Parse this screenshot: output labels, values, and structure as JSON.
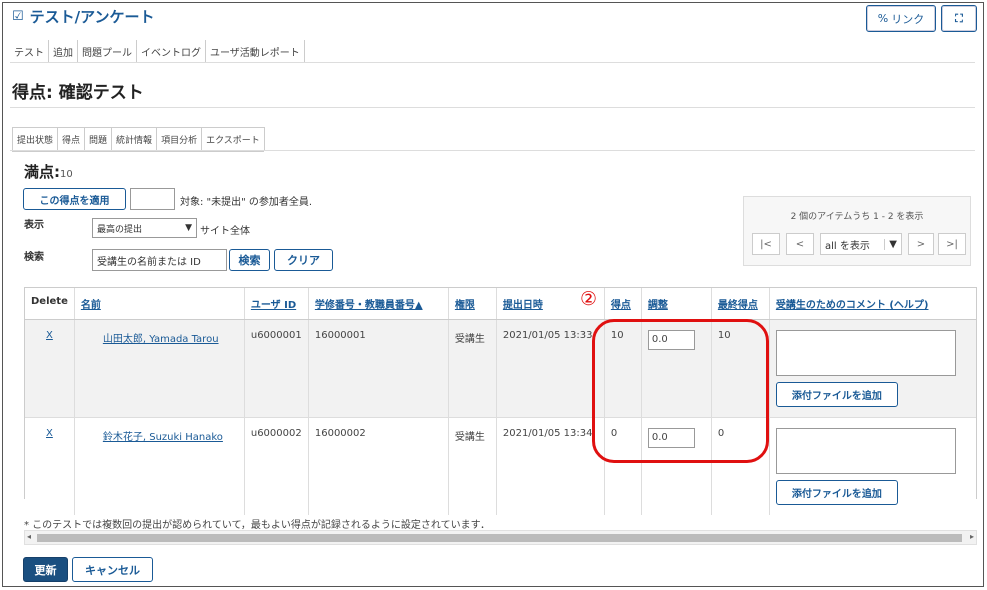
{
  "header": {
    "tool_icon": "check-square-icon",
    "title": "テスト/アンケート",
    "link_label": "リンク",
    "link_icon": "link-icon",
    "expand_icon": "expand-icon"
  },
  "nav": [
    "テスト",
    "追加",
    "問題プール",
    "イベントログ",
    "ユーザ活動レポート"
  ],
  "page_title": "得点: 確認テスト",
  "subtabs": [
    "提出状態",
    "得点",
    "問題",
    "統計情報",
    "項目分析",
    "エクスポート"
  ],
  "max_score": {
    "label": "満点:",
    "value": "10"
  },
  "apply": {
    "button": "この得点を適用",
    "value": "",
    "target_text": "対象: \"未提出\" の参加者全員."
  },
  "display": {
    "label": "表示",
    "selected": "最高の提出",
    "scope": "サイト全体"
  },
  "search": {
    "label": "検索",
    "placeholder": "受講生の名前または ID",
    "search_button": "検索",
    "clear_button": "クリア"
  },
  "pager": {
    "info": "2 個のアイテムうち 1 - 2 を表示",
    "first": "|<",
    "prev": "<",
    "show_selected": "all を表示",
    "next": ">",
    "last": ">|"
  },
  "table": {
    "headers": [
      "Delete",
      "名前",
      "ユーザ ID",
      "学修番号・教職員番号▲",
      "権限",
      "提出日時",
      "得点",
      "調整",
      "最終得点",
      "受講生のためのコメント",
      "(ヘルプ)"
    ],
    "rows": [
      {
        "delete": "X",
        "name": "山田太郎, Yamada Tarou",
        "user_id": "u6000001",
        "number": "16000001",
        "role": "受講生",
        "submitted": "2021/01/05 13:33",
        "score": "10",
        "adjust": "0.0",
        "final": "10",
        "comment": "",
        "attach": "添付ファイルを追加"
      },
      {
        "delete": "X",
        "name": "鈴木花子, Suzuki Hanako",
        "user_id": "u6000002",
        "number": "16000002",
        "role": "受講生",
        "submitted": "2021/01/05 13:34",
        "score": "0",
        "adjust": "0.0",
        "final": "0",
        "comment": "",
        "attach": "添付ファイルを追加"
      }
    ]
  },
  "annotation": {
    "number": "②",
    "color": "#e01010"
  },
  "footnote": "* このテストでは複数回の提出が認められていて，最もよい得点が記録されるように設定されています．",
  "actions": {
    "update": "更新",
    "cancel": "キャンセル"
  },
  "colors": {
    "accent": "#1a5a96",
    "primary_button": "#1a4f80",
    "annotation": "#e01010"
  }
}
